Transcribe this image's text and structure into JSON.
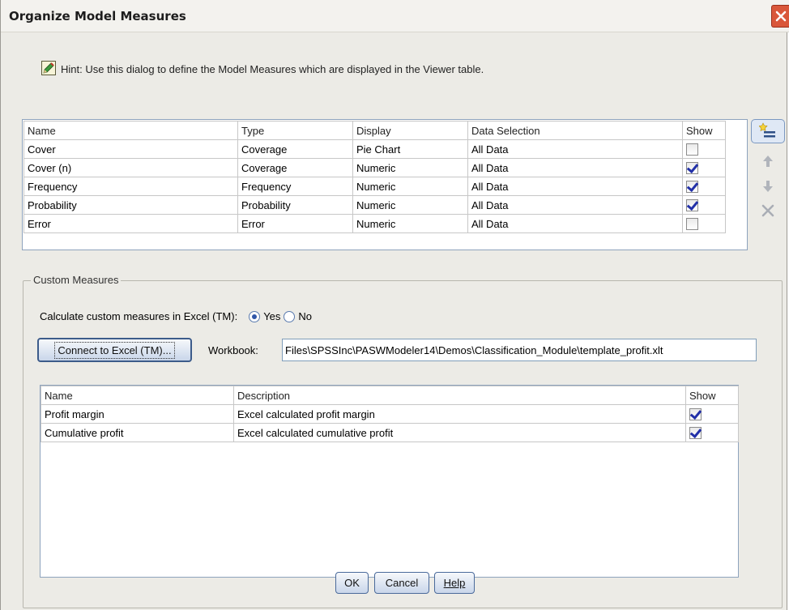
{
  "window": {
    "title": "Organize Model Measures"
  },
  "hint": {
    "text": "Hint: Use this dialog to define the Model Measures which are displayed in the Viewer table."
  },
  "measures_table": {
    "headers": [
      "Name",
      "Type",
      "Display",
      "Data Selection",
      "Show"
    ],
    "rows": [
      {
        "name": "Cover",
        "type": "Coverage",
        "display": "Pie Chart",
        "data_selection": "All Data",
        "show": false
      },
      {
        "name": "Cover (n)",
        "type": "Coverage",
        "display": "Numeric",
        "data_selection": "All Data",
        "show": true
      },
      {
        "name": "Frequency",
        "type": "Frequency",
        "display": "Numeric",
        "data_selection": "All Data",
        "show": true
      },
      {
        "name": "Probability",
        "type": "Probability",
        "display": "Numeric",
        "data_selection": "All Data",
        "show": true
      },
      {
        "name": "Error",
        "type": "Error",
        "display": "Numeric",
        "data_selection": "All Data",
        "show": false
      }
    ]
  },
  "side_buttons": [
    "add-row-icon",
    "move-up-icon",
    "move-down-icon",
    "delete-icon"
  ],
  "custom": {
    "group_label": "Custom Measures",
    "calc_label": "Calculate custom measures in Excel (TM):",
    "yes_label": "Yes",
    "no_label": "No",
    "selected": "Yes",
    "connect_label": "Connect to Excel (TM)...",
    "workbook_label": "Workbook:",
    "workbook_value": "Files\\SPSSInc\\PASWModeler14\\Demos\\Classification_Module\\template_profit.xlt",
    "headers": [
      "Name",
      "Description",
      "Show"
    ],
    "rows": [
      {
        "name": "Profit margin",
        "description": "Excel calculated profit margin",
        "show": true
      },
      {
        "name": "Cumulative profit",
        "description": "Excel calculated cumulative profit",
        "show": true
      }
    ]
  },
  "buttons": {
    "ok": "OK",
    "cancel": "Cancel",
    "help": "Help"
  },
  "colors": {
    "accent": "#2f56a8",
    "checkmark": "#2230a8",
    "close": "#d9573a"
  }
}
